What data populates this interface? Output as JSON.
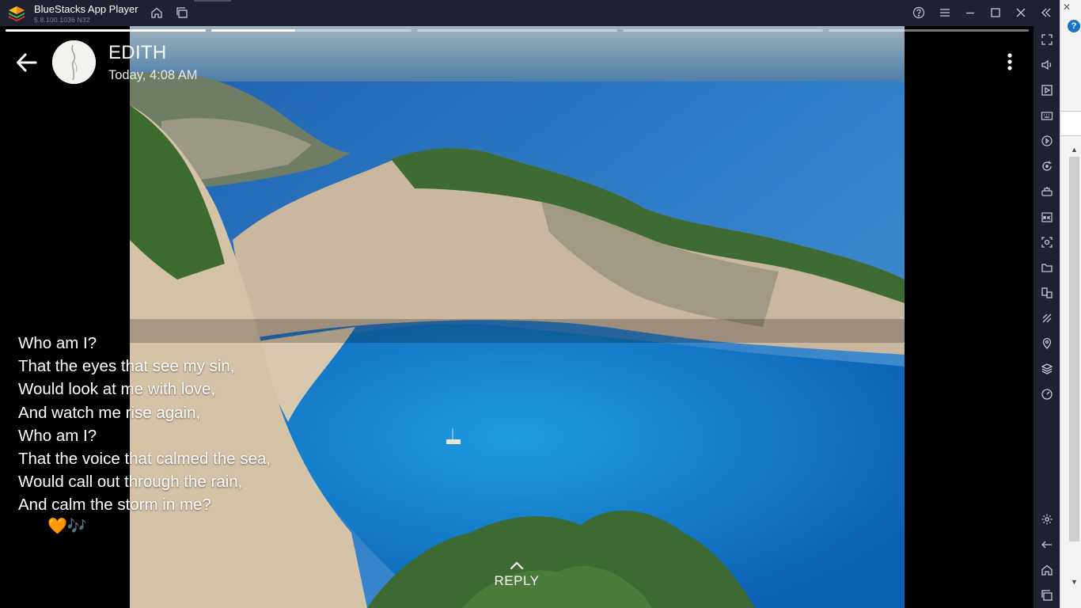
{
  "emulator": {
    "app_name": "BlueStacks App Player",
    "version": "5.8.100.1036 N32",
    "title_icons": [
      "home-icon",
      "multi-instance-icon",
      "help-icon",
      "menu-icon",
      "minimize-icon",
      "maximize-icon",
      "close-icon",
      "collapse-sidebar-icon"
    ],
    "sidebar_icons": [
      "fullscreen-icon",
      "volume-icon",
      "media-manager-icon",
      "keyboard-icon",
      "macro-icon",
      "rotate-icon",
      "game-controls-icon",
      "apk-install-icon",
      "screenshot-icon",
      "folder-icon",
      "multi-window-icon",
      "eco-mode-icon",
      "location-icon",
      "layers-icon",
      "performance-icon",
      "settings-icon",
      "back-icon",
      "home-icon",
      "recents-icon"
    ]
  },
  "status": {
    "contact_name": "EDITH",
    "timestamp": "Today, 4:08 AM",
    "progress": {
      "segments": 5,
      "current_index": 1,
      "current_fraction": 0.42
    },
    "caption_lines": [
      "Who am I?",
      "That the eyes that see my sin,",
      "Would look at me with love,",
      "And watch me rise again,",
      "Who am I?",
      "That the voice that calmed the sea,",
      "Would call out through the rain,",
      "And calm the storm in me?"
    ],
    "caption_emoji": "🧡🎶",
    "reply_label": "REPLY"
  },
  "background_window": {
    "close_glyph": "✕",
    "help_glyph": "?"
  },
  "colors": {
    "chrome": "#1e2130",
    "accent_heart": "#ff8a1f"
  }
}
